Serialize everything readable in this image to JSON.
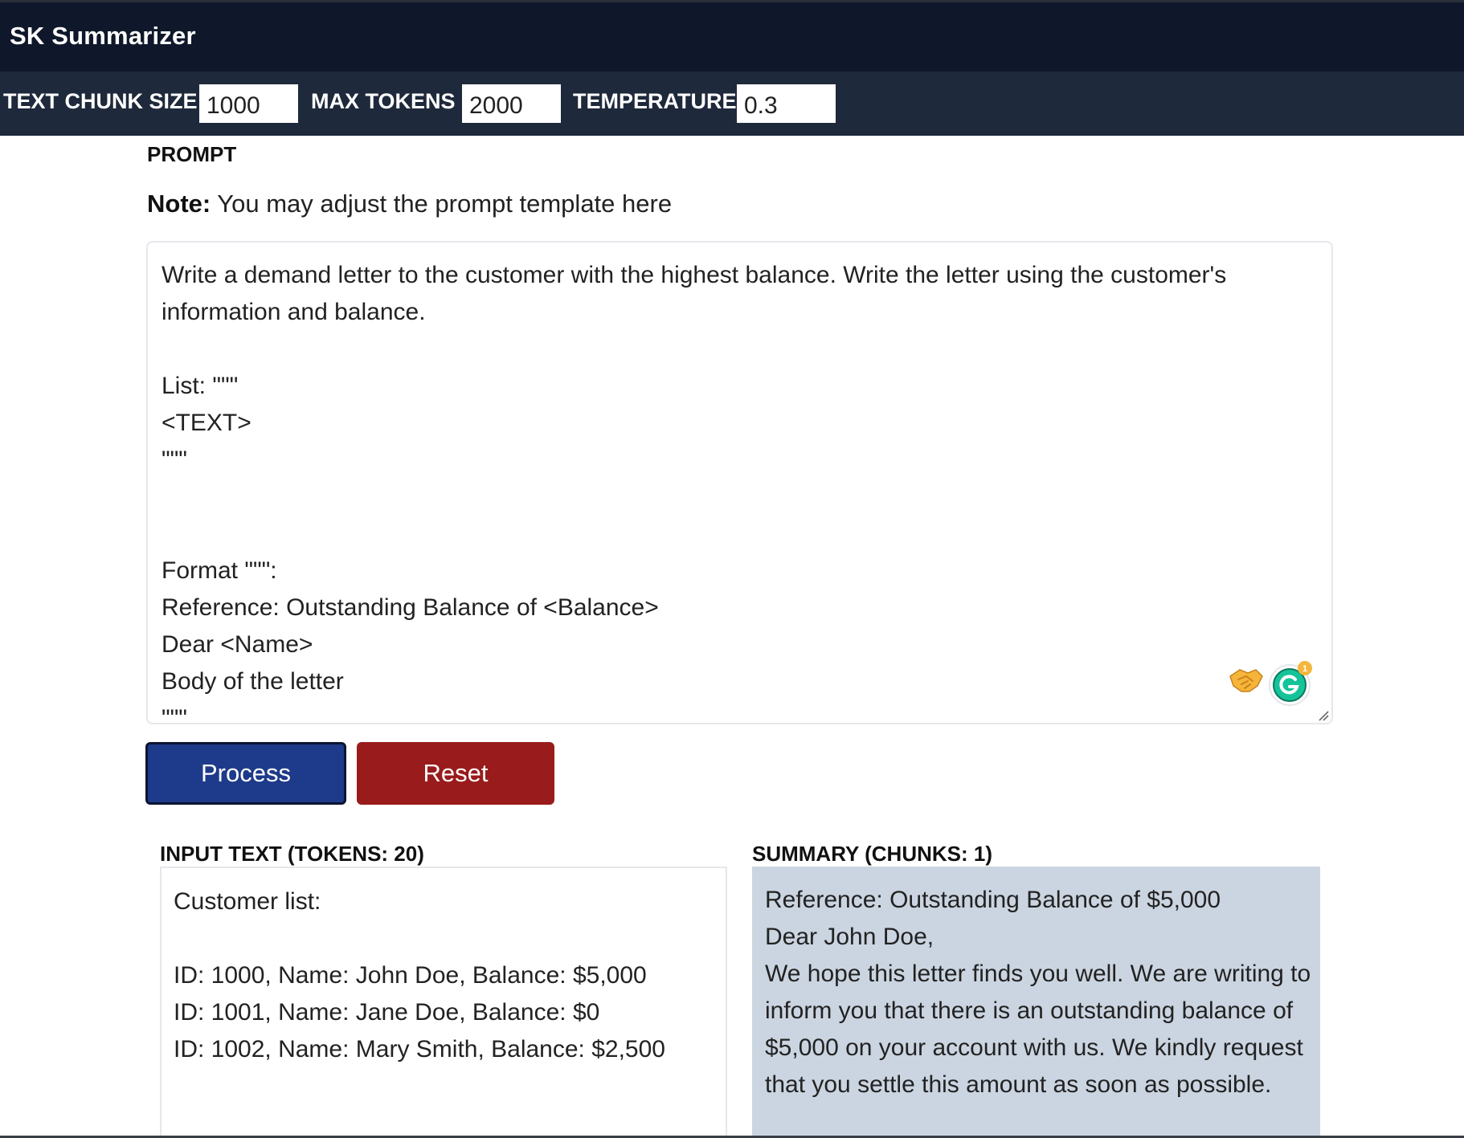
{
  "app": {
    "title": "SK Summarizer"
  },
  "settings": {
    "chunk_size_label": "TEXT CHUNK SIZE",
    "chunk_size_value": "1000",
    "max_tokens_label": "MAX TOKENS",
    "max_tokens_value": "2000",
    "temperature_label": "TEMPERATURE",
    "temperature_value": "0.3"
  },
  "prompt": {
    "heading": "PROMPT",
    "note_label": "Note:",
    "note_text": " You may adjust the prompt template here",
    "template": "Write a demand letter to the customer with the highest balance. Write the letter using the customer's information and balance.\n\nList: \"\"\"\n<TEXT>\n\"\"\"\n\n\nFormat \"\"\":\nReference: Outstanding Balance of <Balance>\nDear <Name>\nBody of the letter\n\"\"\"",
    "grammarly_badge": "1"
  },
  "buttons": {
    "process": "Process",
    "reset": "Reset"
  },
  "input_panel": {
    "heading": "INPUT TEXT (TOKENS: 20)",
    "text": "Customer list:\n\nID: 1000, Name: John Doe, Balance: $5,000\nID: 1001, Name: Jane Doe, Balance: $0\nID: 1002, Name: Mary Smith, Balance: $2,500"
  },
  "summary_panel": {
    "heading": "SUMMARY (CHUNKS: 1)",
    "text": "Reference: Outstanding Balance of $5,000\nDear John Doe,\nWe hope this letter finds you well. We are writing to inform you that there is an outstanding balance of $5,000 on your account with us. We kindly request that you settle this amount as soon as possible."
  },
  "colors": {
    "header_bg": "#0f172a",
    "settings_bg": "#1e293b",
    "process_button": "#1e3a8a",
    "reset_button": "#991b1b",
    "summary_bg": "#cbd5e1"
  }
}
